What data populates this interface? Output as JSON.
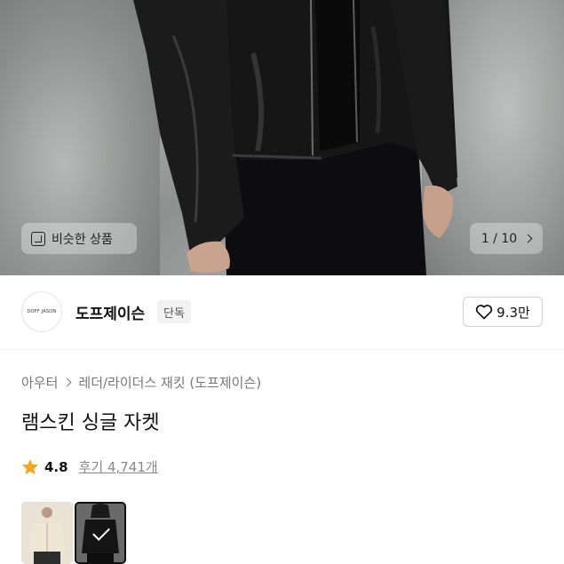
{
  "hero": {
    "similar_label": "비슷한 상품",
    "pager_text": "1 / 10",
    "similar_icon": "similar-items-icon",
    "pager_icon": "chevron-right-icon"
  },
  "brand": {
    "logo_text": "DOFF JASON",
    "name": "도프제이슨",
    "badge": "단독",
    "likes": "9.3만",
    "like_icon": "heart-outline-icon"
  },
  "product": {
    "breadcrumb": [
      "아우터",
      "레더/라이더스 재킷 (도프제이슨)"
    ],
    "title": "램스킨 싱글 자켓",
    "rating": "4.8",
    "reviews": "후기 4,741개",
    "star_color": "#f5a623"
  },
  "thumbnails": [
    {
      "name": "color-option-ivory",
      "selected": false
    },
    {
      "name": "color-option-black",
      "selected": true
    }
  ]
}
